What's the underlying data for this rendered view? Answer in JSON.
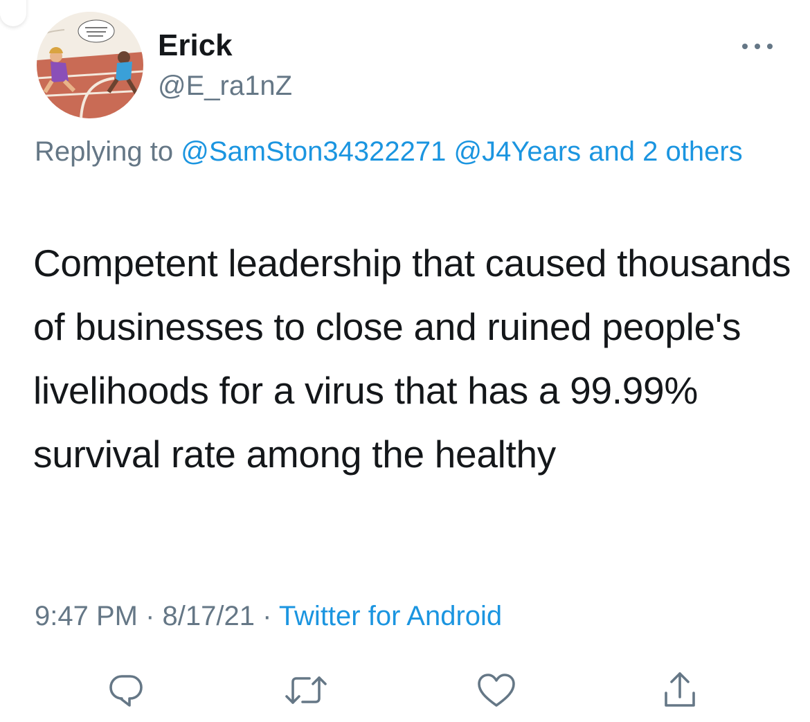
{
  "tweet": {
    "author": {
      "display_name": "Erick",
      "handle": "@E_ra1nZ",
      "avatar_icon": "avatar-cartoon-sprinters"
    },
    "more_icon": "more-horizontal-icon",
    "reply_context": {
      "prefix": "Replying to ",
      "mention_1": "@SamSton34322271",
      "mention_2": "@J4Years",
      "suffix": " and 2 others"
    },
    "text": "Competent leadership that caused thousands of businesses to close and ruined people's livelihoods for a virus that has a 99.99% survival rate among the healthy",
    "time": "9:47 PM",
    "separator": " · ",
    "date": "8/17/21",
    "source": "Twitter for Android",
    "actions": {
      "reply_icon": "reply-icon",
      "retweet_icon": "retweet-icon",
      "like_icon": "heart-icon",
      "share_icon": "share-icon"
    }
  },
  "colors": {
    "text_primary": "#14171a",
    "text_secondary": "#657786",
    "link": "#1b95e0",
    "icon": "#657786"
  }
}
